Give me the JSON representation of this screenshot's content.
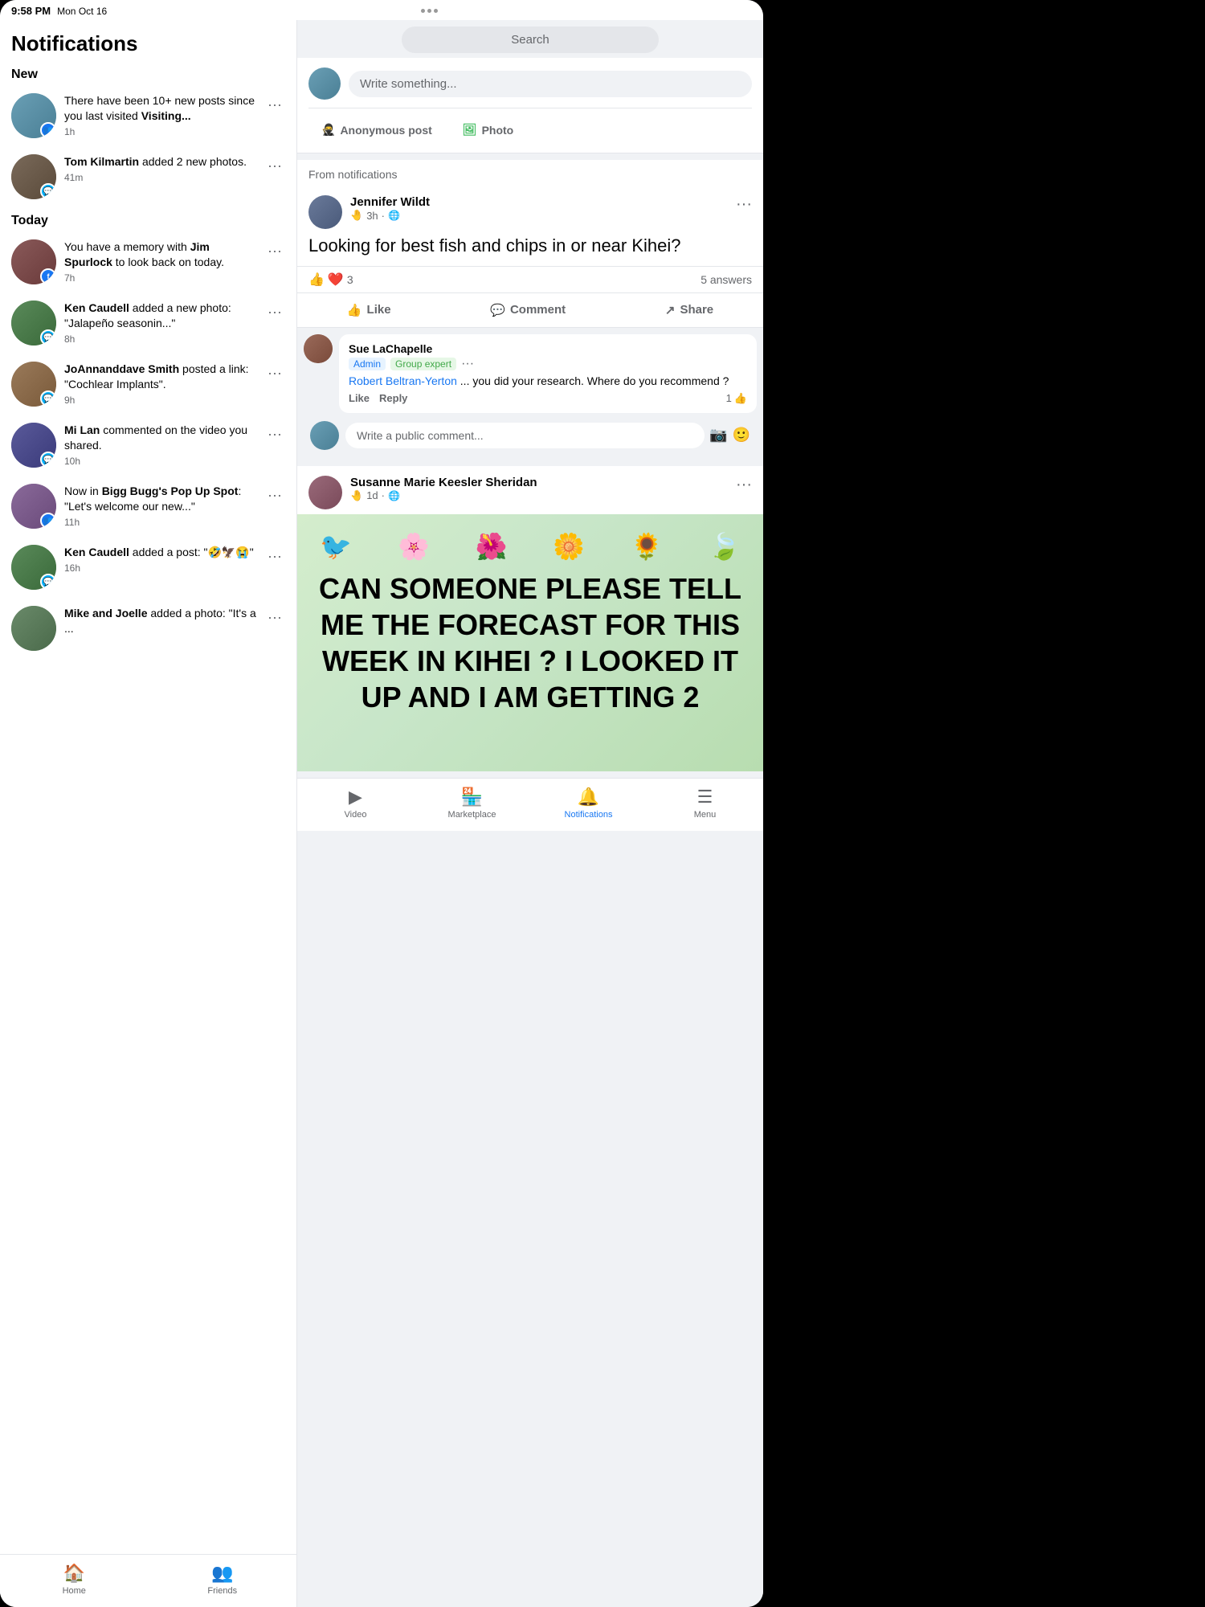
{
  "status_bar": {
    "time": "9:58 PM",
    "day": "Mon Oct 16"
  },
  "notifications": {
    "title": "Notifications",
    "new_label": "New",
    "today_label": "Today",
    "items": [
      {
        "id": "notif1",
        "text": "There have been 10+ new posts since you last visited ",
        "bold": "Visiting...",
        "time": "1h",
        "avatar_class": "av-photo1",
        "badge_type": "group"
      },
      {
        "id": "notif2",
        "text": "Tom Kilmartin",
        "bold_suffix": " added 2 new photos.",
        "time": "41m",
        "avatar_class": "av-photo2",
        "badge_type": "msg"
      },
      {
        "id": "notif3",
        "text": "You have a memory with ",
        "bold": "Jim Spurlock",
        "bold_suffix": " to look back on today.",
        "time": "7h",
        "avatar_class": "av-photo3",
        "badge_type": "fb"
      },
      {
        "id": "notif4",
        "text": "Ken Caudell",
        "bold_suffix": " added a new photo: \"Jalapeño seasonin...\"",
        "time": "8h",
        "avatar_class": "av-photo4",
        "badge_type": "msg"
      },
      {
        "id": "notif5",
        "text": "JoAnnanddave Smith",
        "bold_suffix": " posted a link: \"Cochlear Implants\".",
        "time": "9h",
        "avatar_class": "av-photo5",
        "badge_type": "msg"
      },
      {
        "id": "notif6",
        "text": "Mi Lan",
        "bold_suffix": " commented on the video you shared.",
        "time": "10h",
        "avatar_class": "av-photo6",
        "badge_type": "msg"
      },
      {
        "id": "notif7",
        "text": "Now in ",
        "bold": "Bigg Bugg's Pop Up Spot",
        "bold_suffix": ": \"Let's welcome our new...\"",
        "time": "11h",
        "avatar_class": "av-photo7",
        "badge_type": "group"
      },
      {
        "id": "notif8",
        "text": "Ken Caudell",
        "bold_suffix": " added a post: \"🤣🦅😭\"",
        "time": "16h",
        "avatar_class": "av-photo4",
        "badge_type": "msg"
      },
      {
        "id": "notif9",
        "text": "Mike and Joelle",
        "bold_suffix": " added a photo: \"It's a ...",
        "time": "",
        "avatar_class": "av-photo8",
        "badge_type": ""
      }
    ]
  },
  "left_bottom_nav": {
    "items": [
      {
        "label": "Home",
        "icon": "🏠",
        "active": false
      },
      {
        "label": "Friends",
        "icon": "👥",
        "active": false
      }
    ]
  },
  "right_panel": {
    "search_placeholder": "Search",
    "compose": {
      "placeholder": "Write something...",
      "anonymous_btn": "Anonymous post",
      "photo_btn": "Photo"
    },
    "from_notifications_label": "From notifications",
    "post1": {
      "author": "Jennifer Wildt",
      "time": "3h",
      "privacy": "🌐",
      "emoji_hand": "🤚",
      "body": "Looking for best fish and chips in or near Kihei?",
      "reaction_count": "3",
      "reaction_emojis": [
        "👍",
        "❤️"
      ],
      "answers_label": "5 answers",
      "like_label": "Like",
      "comment_label": "Comment",
      "share_label": "Share",
      "comment": {
        "author": "Sue LaChapelle",
        "tags": [
          "Admin",
          "Group expert"
        ],
        "mention": "Robert Beltran-Yerton",
        "text": " ... you did your research. Where do you recommend ?",
        "like_label": "Like",
        "reply_label": "Reply",
        "like_count": "1",
        "write_placeholder": "Write a public comment..."
      }
    },
    "post2": {
      "author": "Susanne Marie Keesler Sheridan",
      "time": "1d",
      "privacy": "🌐",
      "emoji_hand": "🤚",
      "image_text": "CAN SOMEONE PLEASE TELL ME THE FORECAST FOR THIS WEEK IN KIHEI ? I LOOKED IT UP AND I AM GETTING 2"
    },
    "bottom_nav": {
      "items": [
        {
          "label": "Video",
          "icon": "▶",
          "active": false
        },
        {
          "label": "Marketplace",
          "icon": "🏪",
          "active": false
        },
        {
          "label": "Notifications",
          "icon": "🔔",
          "active": true
        },
        {
          "label": "Menu",
          "icon": "☰",
          "active": false
        }
      ]
    }
  }
}
